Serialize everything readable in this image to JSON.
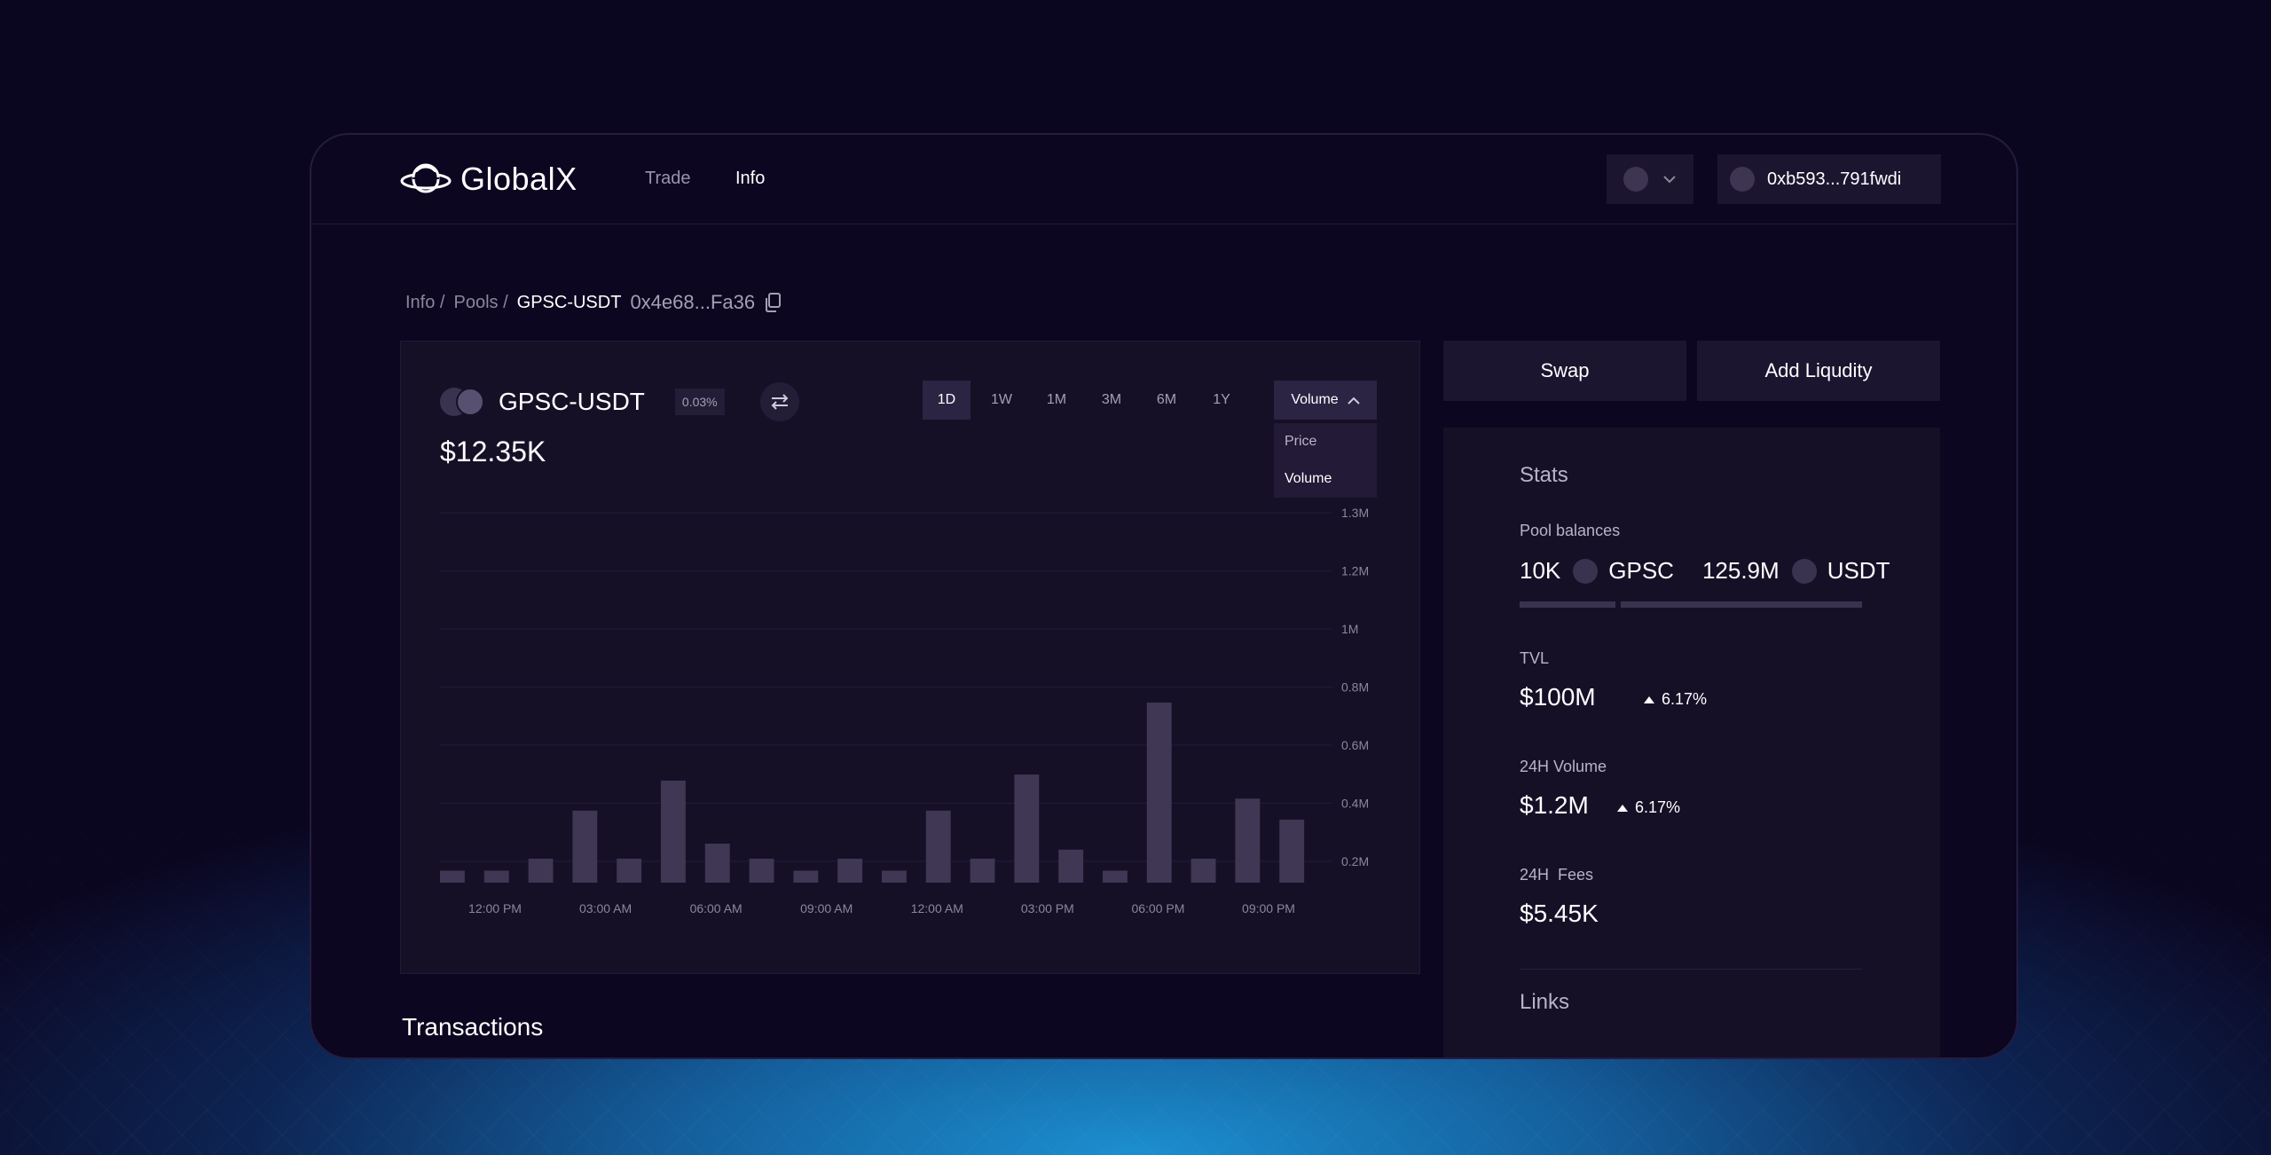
{
  "header": {
    "logo_text": "GlobalX",
    "nav": {
      "trade": "Trade",
      "info": "Info"
    },
    "wallet_address": "0xb593...791fwdi"
  },
  "breadcrumb": {
    "info": "Info /",
    "pools": "Pools /",
    "pair": "GPSC-USDT",
    "address": "0x4e68...Fa36"
  },
  "chart_card": {
    "pair": "GPSC-USDT",
    "fee": "0.03%",
    "value": "$12.35K",
    "ranges": [
      "1D",
      "1W",
      "1M",
      "3M",
      "6M",
      "1Y"
    ],
    "active_range": "1D",
    "metric_select": "Volume",
    "metric_options": [
      "Price",
      "Volume"
    ]
  },
  "chart_data": {
    "type": "bar",
    "series": [
      {
        "values": [
          0.04,
          0.04,
          0.08,
          0.24,
          0.08,
          0.34,
          0.13,
          0.08,
          0.04,
          0.08,
          0.04,
          0.24,
          0.08,
          0.36,
          0.11,
          0.04,
          0.6,
          0.08,
          0.28,
          0.21
        ]
      }
    ],
    "x_tick_labels": [
      "12:00 PM",
      "03:00 AM",
      "06:00 AM",
      "09:00 AM",
      "12:00 AM",
      "03:00 PM",
      "06:00 PM",
      "09:00 PM"
    ],
    "y_tick_labels": [
      "1.3M",
      "1.2M",
      "1M",
      "0.8M",
      "0.6M",
      "0.4M",
      "0.2M"
    ],
    "ylim": [
      0,
      1.25
    ],
    "grid": true,
    "color": "#3f3754"
  },
  "sections": {
    "transactions": "Transactions"
  },
  "actions": {
    "swap": "Swap",
    "add_liquidity": "Add Liqudity"
  },
  "stats": {
    "title": "Stats",
    "pool_balances_label": "Pool balances",
    "balance_a": "10K",
    "token_a": "GPSC",
    "balance_b": "125.9M",
    "token_b": "USDT",
    "tvl_label": "TVL",
    "tvl_value": "$100M",
    "tvl_change": "6.17%",
    "volume_label": "24H Volume",
    "volume_value": "$1.2M",
    "volume_change": "6.17%",
    "fees_label": "24H  Fees",
    "fees_value": "$5.45K",
    "links_label": "Links"
  },
  "colors": {
    "background": "#0b0620",
    "card": "#161027",
    "accent_glow": "#1c8fd0",
    "bar": "#3f3754"
  }
}
